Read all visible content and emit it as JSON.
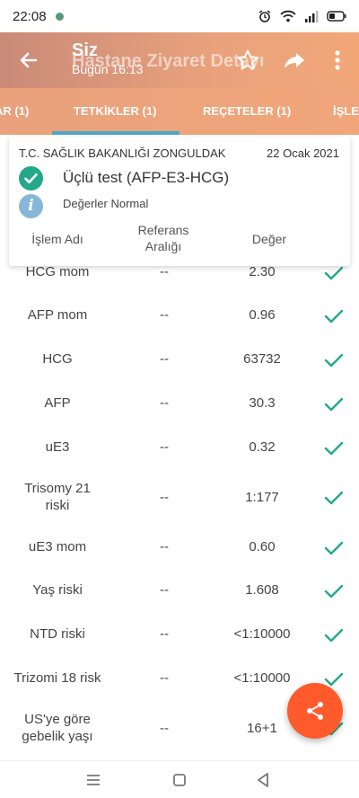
{
  "status_bar": {
    "time": "22:08"
  },
  "app_bar": {
    "title": "Siz",
    "title_ghost": "Hastane Ziyaret Detayı",
    "subtitle": "Bugün 16:13"
  },
  "tabs": [
    {
      "label": "AR (1)",
      "active": false
    },
    {
      "label": "TETKİKLER (1)",
      "active": true
    },
    {
      "label": "REÇETELER (1)",
      "active": false
    },
    {
      "label": "İŞLE",
      "active": false
    }
  ],
  "card": {
    "institution": "T.C. SAĞLIK BAKANLIĞI ZONGULDAK",
    "date": "22 Ocak 2021",
    "test_name": "Üçlü test (AFP-E3-HCG)",
    "info_glyph": "i",
    "status_note": "Değerler Normal",
    "headers": {
      "name": "İşlem Adı",
      "ref_line1": "Referans",
      "ref_line2": "Aralığı",
      "value": "Değer"
    }
  },
  "results": [
    {
      "name": "HCG mom",
      "ref": "--",
      "value": "2.30"
    },
    {
      "name": "AFP mom",
      "ref": "--",
      "value": "0.96"
    },
    {
      "name": "HCG",
      "ref": "--",
      "value": "63732"
    },
    {
      "name": "AFP",
      "ref": "--",
      "value": "30.3"
    },
    {
      "name": "uE3",
      "ref": "--",
      "value": "0.32"
    },
    {
      "name": "Trisomy 21 risk",
      "name_line1": "Trisomy 21",
      "name_line2": "riski",
      "ref": "--",
      "value": "1:177"
    },
    {
      "name": "uE3 mom",
      "ref": "--",
      "value": "0.60"
    },
    {
      "name": "Yaş riski",
      "ref": "--",
      "value": "1.608"
    },
    {
      "name": "NTD riski",
      "ref": "--",
      "value": "<1:10000"
    },
    {
      "name": "Trizomi 18 risk",
      "ref": "--",
      "value": "<1:10000"
    },
    {
      "name_line1": "US'ye göre",
      "name_line2": "gebelik yaşı",
      "ref": "--",
      "value": "16+1"
    }
  ],
  "icons": {
    "back": "arrow-left-icon",
    "star": "star-outline-icon",
    "share": "share-arrow-icon",
    "more": "more-vertical-icon",
    "check": "check-icon",
    "info": "info-icon",
    "fab_share": "share-icon"
  },
  "colors": {
    "app_bar": "#e9a27c",
    "tab_indicator": "#4da6c8",
    "check": "#23a98a",
    "info": "#86b7d9",
    "fab": "#ff5a2c"
  }
}
